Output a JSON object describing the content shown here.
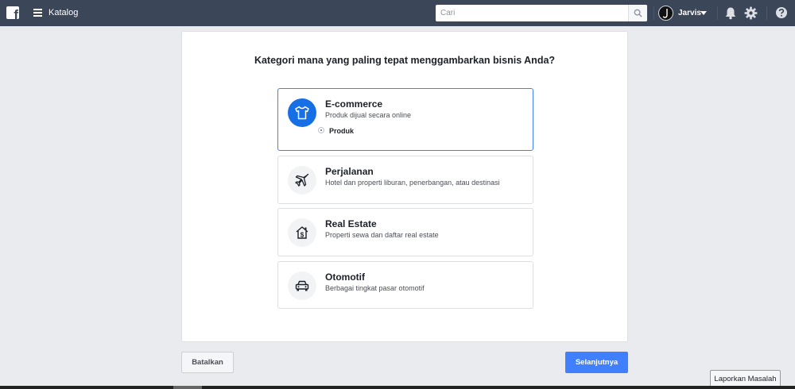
{
  "topbar": {
    "logo_letter": "f",
    "app_title": "Katalog",
    "search_placeholder": "Cari",
    "user_name": "Jarvis",
    "bar_color": "#3b4659",
    "icons": [
      "facebook-logo-icon",
      "menu-icon",
      "search-icon",
      "bell-icon",
      "gear-icon",
      "help-icon"
    ]
  },
  "main": {
    "question": "Kategori mana yang paling tepat menggambarkan bisnis Anda?",
    "options": [
      {
        "title": "E-commerce",
        "description": "Produk dijual secara online",
        "icon": "tshirt-icon",
        "selected": true,
        "sub_option": "Produk"
      },
      {
        "title": "Perjalanan",
        "description": "Hotel dan properti liburan, penerbangan, atau destinasi",
        "icon": "airplane-icon",
        "selected": false
      },
      {
        "title": "Real Estate",
        "description": "Properti sewa dan daftar real estate",
        "icon": "house-dollar-icon",
        "selected": false
      },
      {
        "title": "Otomotif",
        "description": "Berbagai tingkat pasar otomotif",
        "icon": "car-icon",
        "selected": false
      }
    ]
  },
  "footer": {
    "cancel_label": "Batalkan",
    "next_label": "Selanjutnya",
    "report_label": "Laporkan Masalah",
    "accent_color": "#4080ff"
  }
}
